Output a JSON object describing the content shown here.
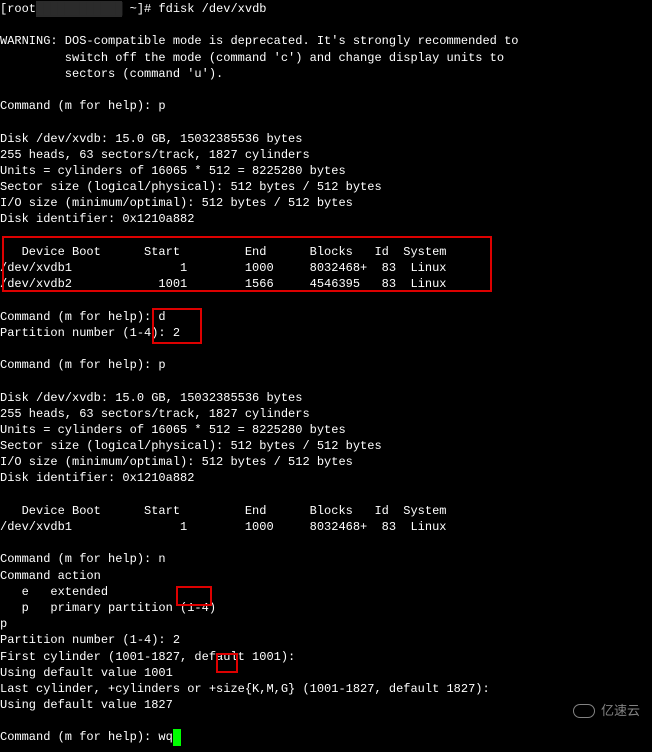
{
  "prompt": {
    "user": "root",
    "masked": "████████████",
    "host_tail": " ~]# ",
    "cmd": "fdisk /dev/xvdb"
  },
  "warning": {
    "l1": "WARNING: DOS-compatible mode is deprecated. It's strongly recommended to",
    "l2": "         switch off the mode (command 'c') and change display units to",
    "l3": "         sectors (command 'u')."
  },
  "cmd_p1": "Command (m for help): p",
  "disk1": {
    "header": "Disk /dev/xvdb: 15.0 GB, 15032385536 bytes",
    "geom": "255 heads, 63 sectors/track, 1827 cylinders",
    "units": "Units = cylinders of 16065 * 512 = 8225280 bytes",
    "sector": "Sector size (logical/physical): 512 bytes / 512 bytes",
    "io": "I/O size (minimum/optimal): 512 bytes / 512 bytes",
    "id": "Disk identifier: 0x1210a882"
  },
  "tbl_hdr": "   Device Boot      Start         End      Blocks   Id  System",
  "tbl1_r1": "/dev/xvdb1               1        1000     8032468+  83  Linux",
  "tbl1_r2": "/dev/xvdb2            1001        1566     4546395   83  Linux",
  "cmd_d": "Command (m for help): d",
  "partnum_d": "Partition number (1-4): 2",
  "cmd_p2": "Command (m for help): p",
  "tbl2_r1": "/dev/xvdb1               1        1000     8032468+  83  Linux",
  "cmd_n": "Command (m for help): n",
  "action": {
    "hdr": "Command action",
    "e": "   e   extended",
    "p": "   p   primary partition (1-4)"
  },
  "sel_p": "p",
  "partnum_n": "Partition number (1-4): 2",
  "firstcyl": "First cylinder (1001-1827, default 1001):",
  "def1001": "Using default value 1001",
  "lastcyl": "Last cylinder, +cylinders or +size{K,M,G} (1001-1827, default 1827):",
  "def1827": "Using default value 1827",
  "cmd_wq": "Command (m for help): wq",
  "watermark": "亿速云"
}
